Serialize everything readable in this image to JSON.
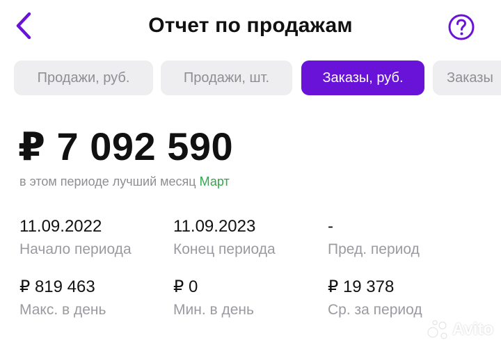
{
  "colors": {
    "accent": "#6a13d8",
    "positive": "#2fa84a",
    "tab_inactive_bg": "#eeeef0",
    "secondary_text": "#9a9aa0"
  },
  "header": {
    "title": "Отчет по продажам",
    "back_icon": "chevron-left-icon",
    "help_icon": "question-circle-icon"
  },
  "tabs": [
    {
      "label": "Продажи, руб.",
      "active": false
    },
    {
      "label": "Продажи, шт.",
      "active": false
    },
    {
      "label": "Заказы, руб.",
      "active": true
    },
    {
      "label": "Заказы",
      "active": false
    }
  ],
  "summary": {
    "total": "₽ 7 092 590",
    "best_month_text": "в этом периоде лучший месяц",
    "best_month": "Март"
  },
  "stats": [
    {
      "value": "11.09.2022",
      "label": "Начало периода"
    },
    {
      "value": "11.09.2023",
      "label": "Конец периода"
    },
    {
      "value": "-",
      "label": "Пред. период"
    },
    {
      "value": "₽ 819 463",
      "label": "Макс. в день"
    },
    {
      "value": "₽ 0",
      "label": "Мин. в день"
    },
    {
      "value": "₽ 19 378",
      "label": "Ср. за период"
    }
  ],
  "watermark": "Avito"
}
